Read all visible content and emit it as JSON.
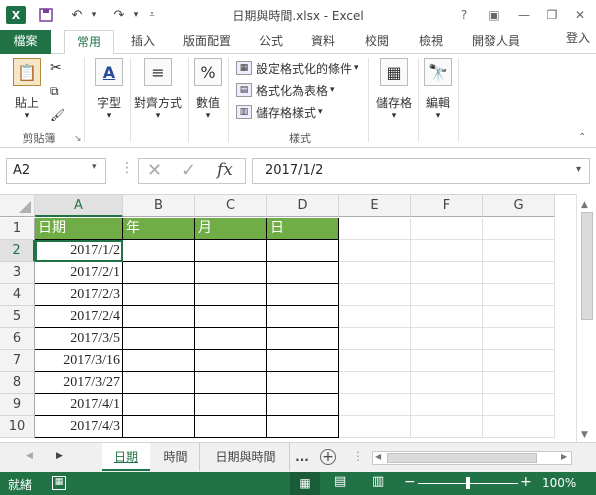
{
  "titlebar": {
    "app_icon": "X",
    "title": "日期與時間.xlsx - Excel",
    "help": "?",
    "signin": "登入"
  },
  "tabs": [
    "檔案",
    "常用",
    "插入",
    "版面配置",
    "公式",
    "資料",
    "校閱",
    "檢視",
    "開發人員"
  ],
  "ribbon": {
    "paste_label": "貼上",
    "clipboard_group": "剪貼簿",
    "font_label": "字型",
    "align_label": "對齊方式",
    "number_label": "數值",
    "number_icon": "%",
    "cond_format": "設定格式化的條件",
    "format_table": "格式化為表格",
    "cell_styles": "儲存格樣式",
    "styles_group": "樣式",
    "cells_label": "儲存格",
    "editing_label": "編輯"
  },
  "formula_bar": {
    "name_box": "A2",
    "fx": "fx",
    "content": "2017/1/2"
  },
  "columns": [
    "A",
    "B",
    "C",
    "D",
    "E",
    "F",
    "G"
  ],
  "rows": [
    "1",
    "2",
    "3",
    "4",
    "5",
    "6",
    "7",
    "8",
    "9",
    "10"
  ],
  "header_cells": [
    "日期",
    "年",
    "月",
    "日"
  ],
  "dates": [
    "2017/1/2",
    "2017/2/1",
    "2017/2/3",
    "2017/2/4",
    "2017/3/5",
    "2017/3/16",
    "2017/3/27",
    "2017/4/1",
    "2017/4/3"
  ],
  "sheets": {
    "tab1": "日期",
    "tab2": "時間",
    "tab3": "日期與時間",
    "more": "..."
  },
  "status": {
    "ready": "就緒",
    "zoom": "100%",
    "zoom_value": 100
  },
  "colors": {
    "excel_green": "#217346",
    "header_fill": "#70ad47"
  }
}
